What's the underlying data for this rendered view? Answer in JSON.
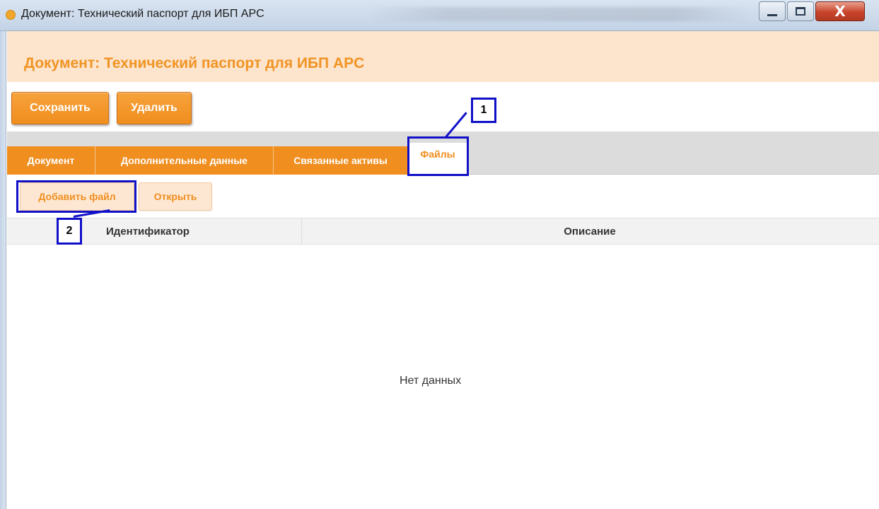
{
  "window": {
    "title": "Документ: Технический паспорт для ИБП APC",
    "close_glyph": "X",
    "icons": [
      "status-dot-icon",
      "minimize-icon",
      "maximize-icon",
      "close-icon"
    ]
  },
  "document": {
    "header_title": "Документ: Технический паспорт для ИБП APC"
  },
  "toolbar": {
    "save_label": "Сохранить",
    "delete_label": "Удалить"
  },
  "tabs": [
    {
      "label": "Документ",
      "active": false
    },
    {
      "label": "Дополнительные данные",
      "active": false
    },
    {
      "label": "Связанные активы",
      "active": false
    },
    {
      "label": "Файлы",
      "active": true
    }
  ],
  "files": {
    "add_file_label": "Добавить файл",
    "open_label": "Открыть"
  },
  "grid": {
    "columns": [
      "Идентификатор",
      "Описание"
    ],
    "empty_text": "Нет данных"
  },
  "annotations": {
    "callout_1": "1",
    "callout_2": "2",
    "callout_color": "#1010c8"
  },
  "colors": {
    "accent": "#f08e1f",
    "header_bg": "#fde4cc",
    "title_color": "#f09424"
  }
}
